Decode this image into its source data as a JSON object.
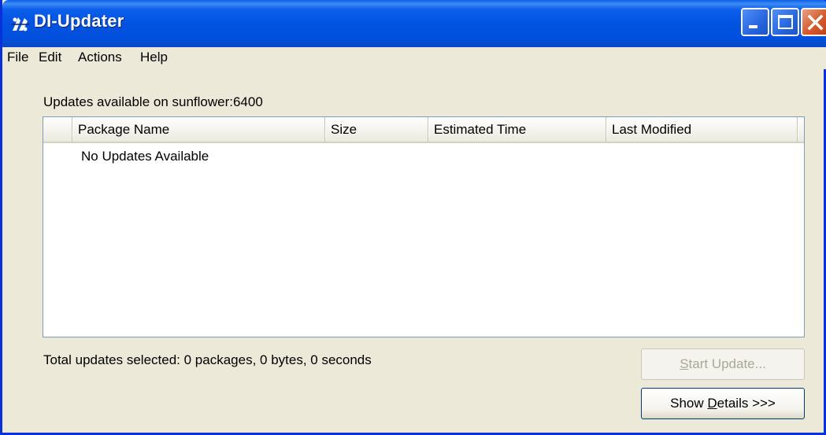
{
  "window": {
    "title": "DI-Updater",
    "app_icon": "di-updater-logo-icon",
    "controls": [
      "minimize-icon",
      "maximize-icon",
      "close-icon"
    ]
  },
  "menubar": {
    "items": [
      "File",
      "Edit",
      "Actions",
      "Help"
    ]
  },
  "main": {
    "server_label": "Updates available on sunflower:6400",
    "columns": [
      "Package Name",
      "Size",
      "Estimated Time",
      "Last Modified"
    ],
    "empty_message": "No Updates Available",
    "total_summary": "Total updates selected: 0 packages, 0 bytes, 0 seconds"
  },
  "buttons": {
    "start_update": {
      "prefix": "",
      "mnemonic": "S",
      "suffix": "tart Update...",
      "enabled": false
    },
    "show_details": {
      "prefix": "Show ",
      "mnemonic": "D",
      "suffix": "etails >>>",
      "enabled": true
    }
  },
  "colors": {
    "titlebar": "#0152e0",
    "window_face": "#ece9d8",
    "close_button": "#d55a2d",
    "disabled_text": "#aca899"
  }
}
